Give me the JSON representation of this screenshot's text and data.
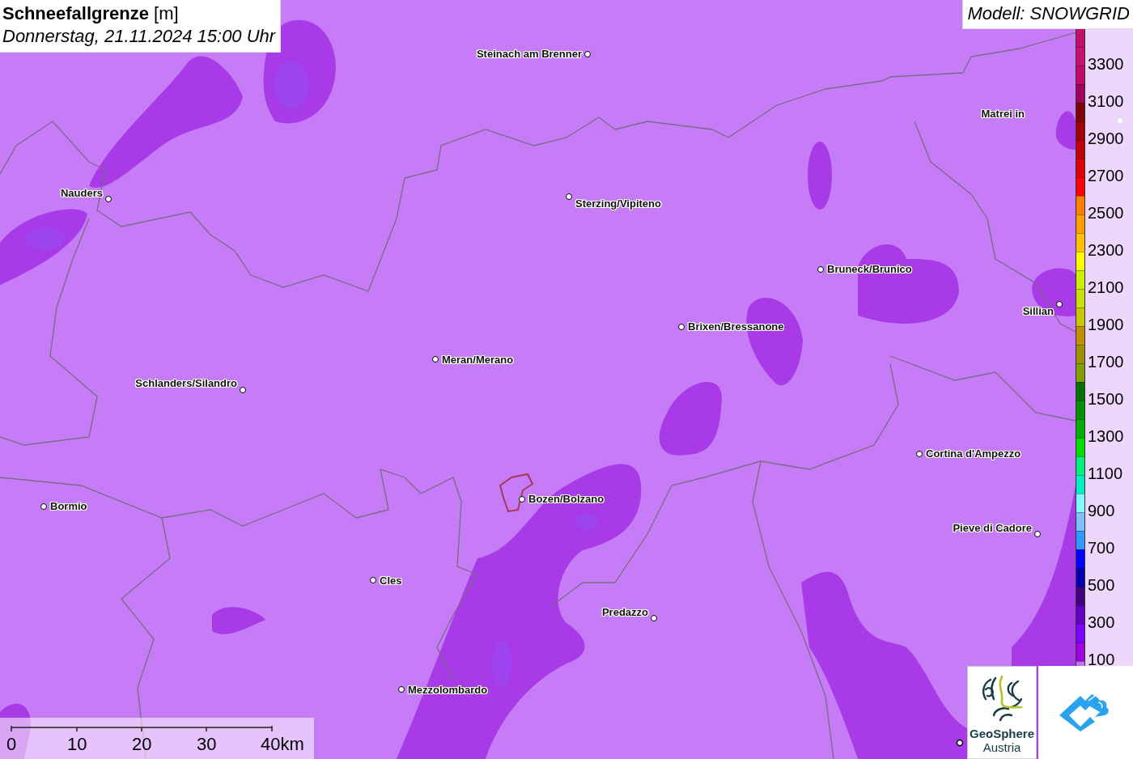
{
  "title": {
    "heading": "**Schneefallgrenze** [m]",
    "datetime": "Donnerstag, 21.11.2024 15:00 Uhr"
  },
  "model_label": "Modell: SNOWGRID",
  "places": [
    {
      "name": "Steinach am Brenner"
    },
    {
      "name": "Nauders"
    },
    {
      "name": "Sterzing/Vipiteno"
    },
    {
      "name": "Matrei in"
    },
    {
      "name": "Bruneck/Brunico"
    },
    {
      "name": "Sillian"
    },
    {
      "name": "Brixen/Bressanone"
    },
    {
      "name": "Meran/Merano"
    },
    {
      "name": "Schlanders/Silandro"
    },
    {
      "name": "Cortina d'Ampezzo"
    },
    {
      "name": "Bozen/Bolzano"
    },
    {
      "name": "Bormio"
    },
    {
      "name": "Pieve di Cadore"
    },
    {
      "name": "Cles"
    },
    {
      "name": "Predazzo"
    },
    {
      "name": "Mezzolombardo"
    }
  ],
  "legend": {
    "bands": [
      {
        "color": "#c0106a"
      },
      {
        "color": "#c8106e"
      },
      {
        "color": "#c00c68"
      },
      {
        "color": "#a00060"
      },
      {
        "color": "#800000"
      },
      {
        "color": "#a00000"
      },
      {
        "color": "#c00000"
      },
      {
        "color": "#e00000"
      },
      {
        "color": "#ff0000"
      },
      {
        "color": "#ff8000"
      },
      {
        "color": "#ffa000"
      },
      {
        "color": "#ffc000"
      },
      {
        "color": "#ffff00"
      },
      {
        "color": "#c8f000"
      },
      {
        "color": "#c8e000"
      },
      {
        "color": "#c8c800"
      },
      {
        "color": "#c09000"
      },
      {
        "color": "#a09000"
      },
      {
        "color": "#80a000"
      },
      {
        "color": "#007000"
      },
      {
        "color": "#009000"
      },
      {
        "color": "#00b000"
      },
      {
        "color": "#00e000"
      },
      {
        "color": "#00f080"
      },
      {
        "color": "#00f0c0"
      },
      {
        "color": "#80ffff"
      },
      {
        "color": "#80c0ff"
      },
      {
        "color": "#3399ff"
      },
      {
        "color": "#0000ff"
      },
      {
        "color": "#0000b0"
      },
      {
        "color": "#400080"
      },
      {
        "color": "#6000c0"
      },
      {
        "color": "#8000ff"
      },
      {
        "color": "#a000e0"
      },
      {
        "color": "#c870f0"
      }
    ],
    "labels": [
      "3300",
      "3100",
      "2900",
      "2700",
      "2500",
      "2300",
      "2100",
      "1900",
      "1700",
      "1500",
      "1300",
      "1100",
      "900",
      "700",
      "500",
      "300",
      "100"
    ]
  },
  "scale_bar": {
    "ticks": [
      "0",
      "10",
      "20",
      "30",
      "40km"
    ]
  },
  "logo": {
    "line1": "GeoSphere",
    "line2": "Austria"
  }
}
